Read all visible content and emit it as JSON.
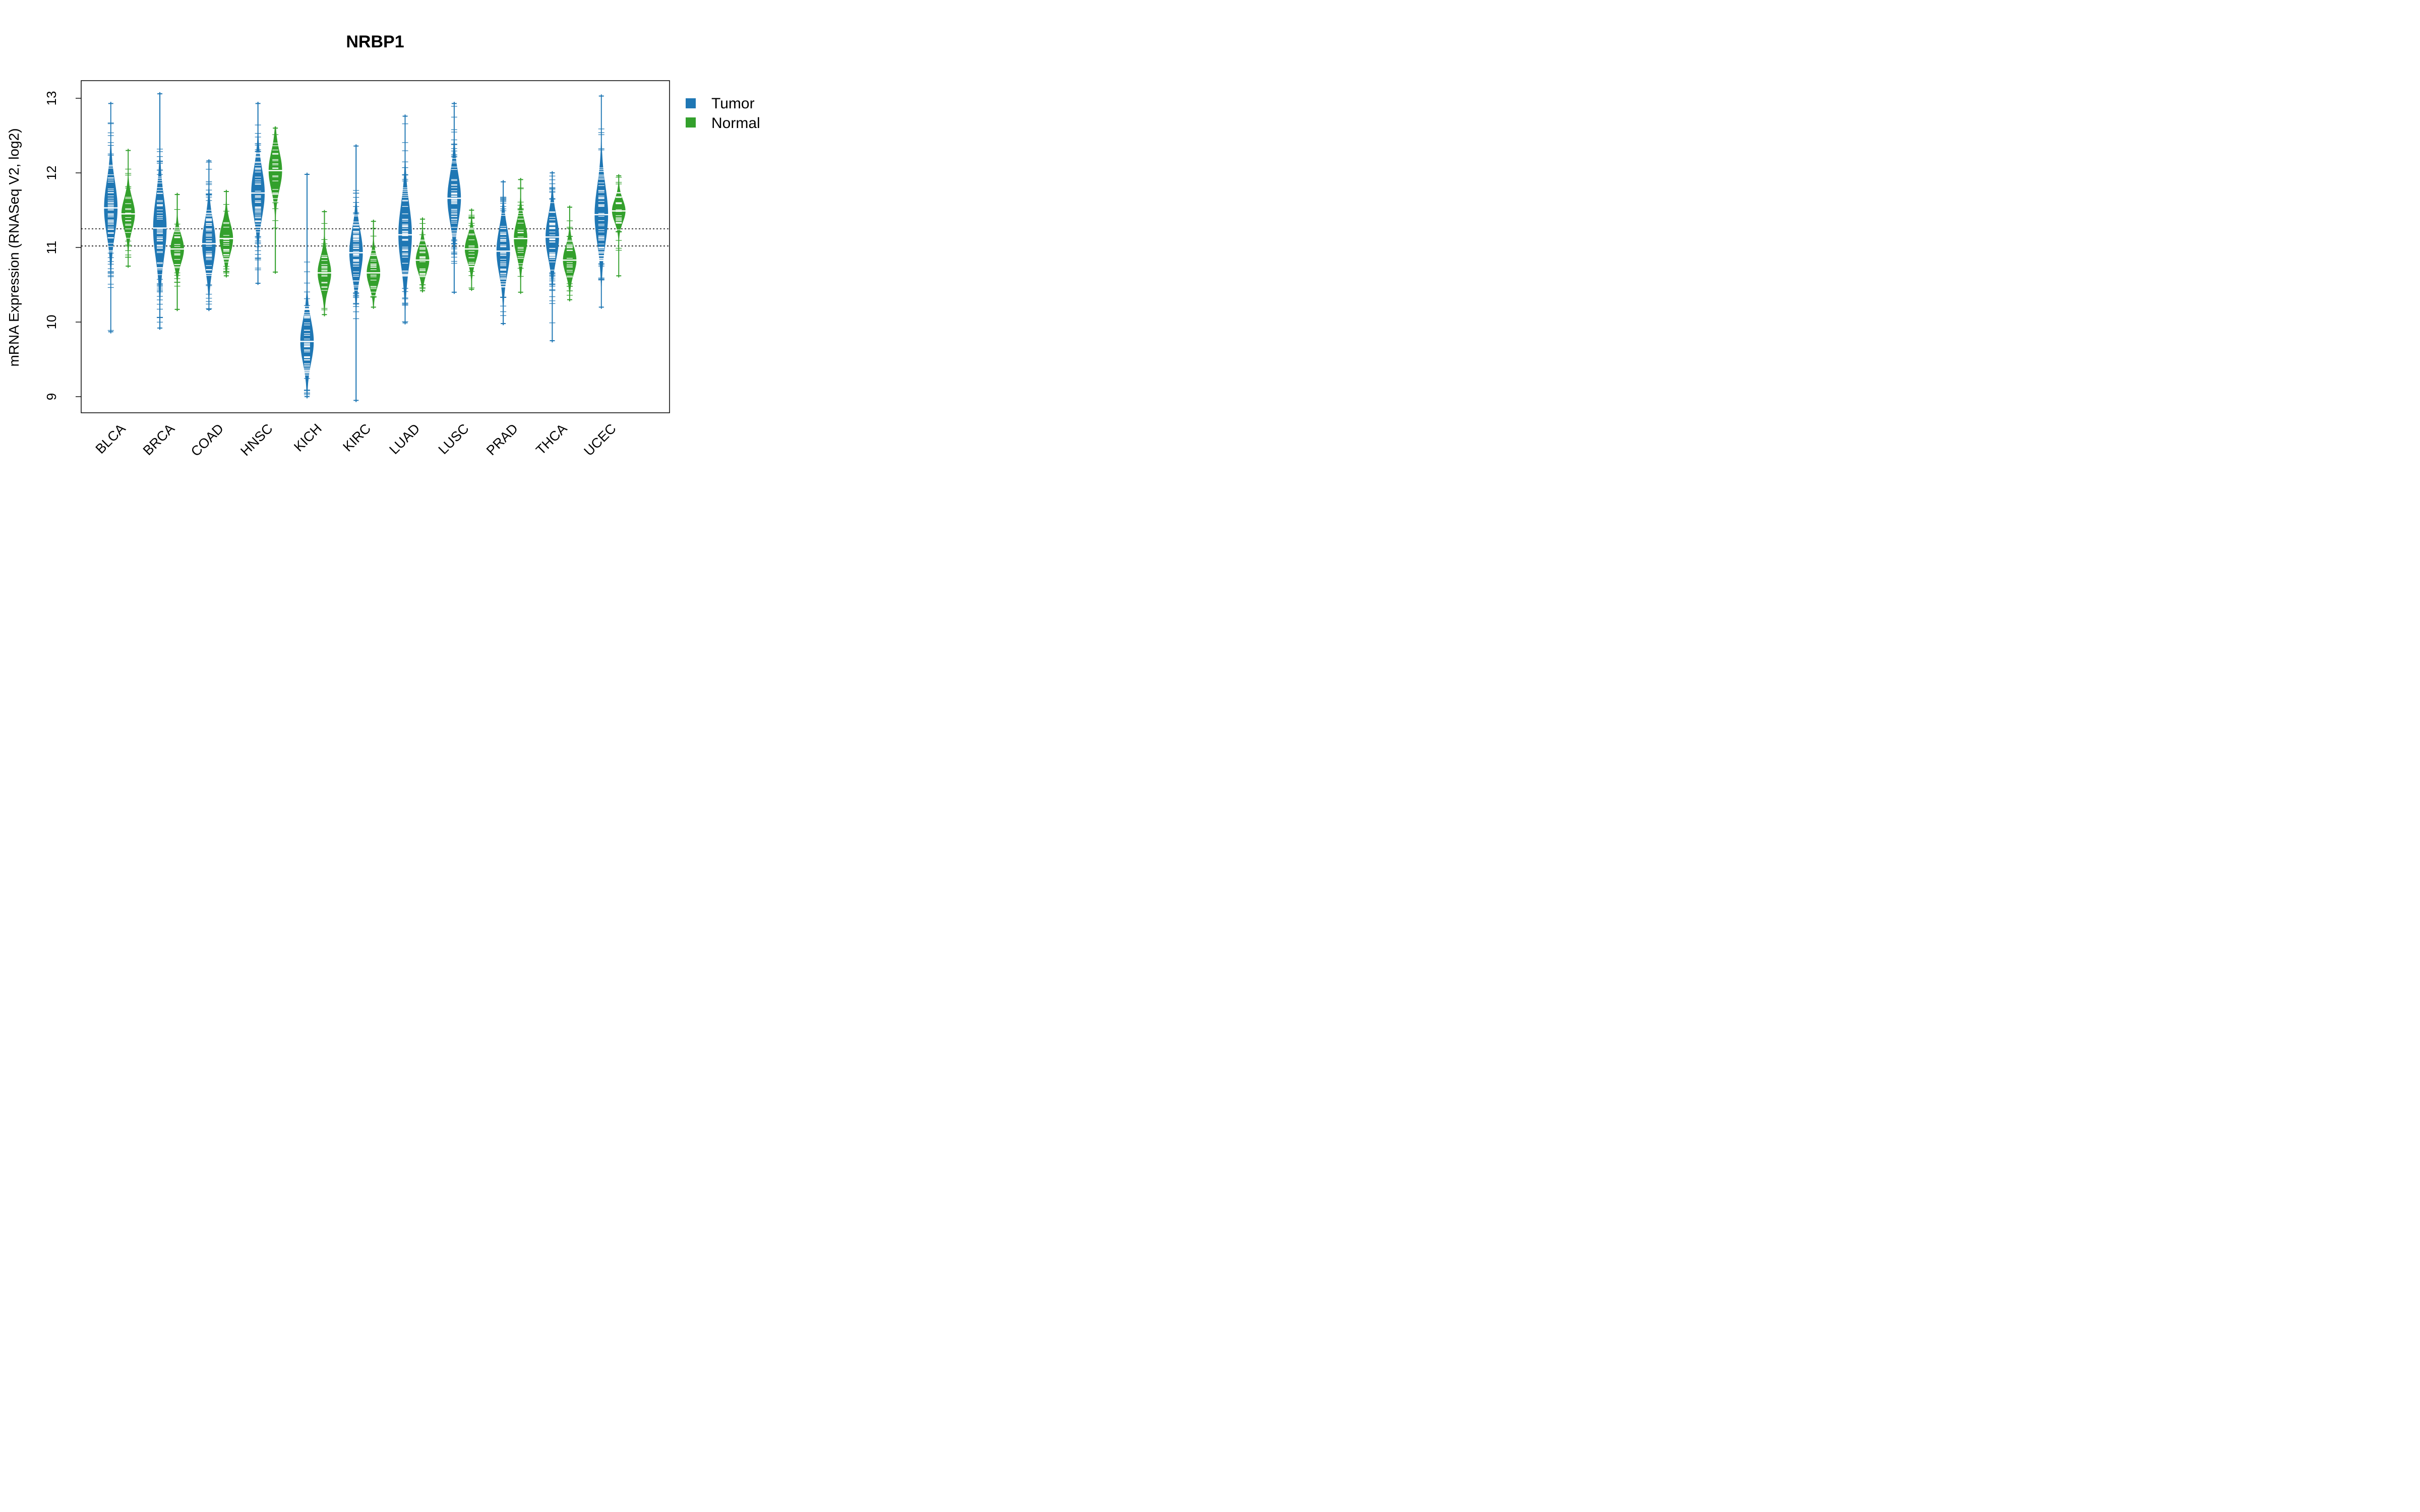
{
  "chart_data": {
    "type": "beanplot",
    "title": "NRBP1",
    "xlabel": "",
    "ylabel": "mRNA Expression (RNASeq V2, log2)",
    "ylim": [
      8.85,
      13.3
    ],
    "yticks": [
      9,
      10,
      11,
      12,
      13
    ],
    "grid": false,
    "reference_lines": [
      11.02,
      11.25
    ],
    "legend": {
      "position": "top-right-outside",
      "entries": [
        {
          "label": "Tumor",
          "color": "#1F77B4"
        },
        {
          "label": "Normal",
          "color": "#33A02C"
        }
      ]
    },
    "categories": [
      "BLCA",
      "BRCA",
      "COAD",
      "HNSC",
      "KICH",
      "KIRC",
      "LUAD",
      "LUSC",
      "PRAD",
      "THCA",
      "UCEC"
    ],
    "series": [
      {
        "name": "Tumor",
        "color": "#1F77B4",
        "median": [
          11.53,
          11.26,
          11.05,
          11.73,
          9.74,
          10.93,
          11.17,
          11.66,
          10.95,
          11.14,
          11.44
        ],
        "min": [
          9.85,
          9.9,
          10.15,
          10.5,
          8.98,
          8.93,
          9.97,
          10.38,
          9.96,
          9.73,
          10.18
        ],
        "max": [
          12.95,
          13.08,
          12.18,
          12.95,
          12.0,
          12.38,
          12.78,
          12.95,
          11.9,
          12.02,
          13.05
        ],
        "spread": [
          0.35,
          0.4,
          0.3,
          0.32,
          0.28,
          0.3,
          0.4,
          0.32,
          0.3,
          0.28,
          0.38
        ]
      },
      {
        "name": "Normal",
        "color": "#33A02C",
        "median": [
          11.45,
          10.98,
          11.12,
          12.03,
          10.66,
          10.66,
          10.83,
          10.98,
          11.12,
          10.83,
          11.49
        ],
        "min": [
          10.73,
          10.15,
          10.6,
          10.65,
          10.08,
          10.18,
          10.4,
          10.42,
          10.38,
          10.28,
          10.6
        ],
        "max": [
          12.32,
          11.73,
          11.77,
          12.62,
          11.5,
          11.37,
          11.4,
          11.52,
          11.93,
          11.56,
          11.98
        ],
        "spread": [
          0.2,
          0.18,
          0.2,
          0.25,
          0.2,
          0.18,
          0.17,
          0.17,
          0.22,
          0.18,
          0.15
        ]
      }
    ]
  }
}
